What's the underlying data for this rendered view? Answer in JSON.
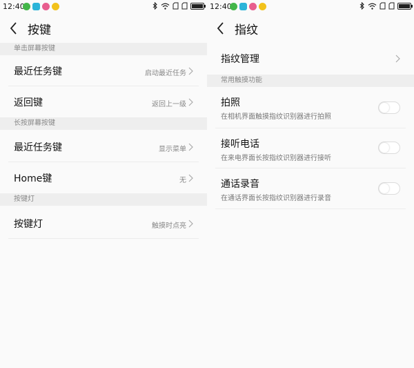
{
  "left": {
    "status": {
      "time": "12:40"
    },
    "title": "按键",
    "sections": [
      {
        "label": "单击屏幕按键"
      },
      {
        "label": "长按屏幕按键"
      },
      {
        "label": "按键灯"
      }
    ],
    "rows": [
      {
        "label": "最近任务键",
        "value": "启动最近任务"
      },
      {
        "label": "返回键",
        "value": "返回上一级"
      },
      {
        "label": "最近任务键",
        "value": "显示菜单"
      },
      {
        "label": "Home键",
        "value": "无"
      },
      {
        "label": "按键灯",
        "value": "触摸时点亮"
      }
    ]
  },
  "right": {
    "status": {
      "time": "12:40"
    },
    "title": "指纹",
    "manage": {
      "label": "指纹管理"
    },
    "section": {
      "label": "常用触摸功能"
    },
    "features": [
      {
        "label": "拍照",
        "desc": "在相机界面触摸指纹识别器进行拍照",
        "enabled": false
      },
      {
        "label": "接听电话",
        "desc": "在来电界面长按指纹识别器进行接听",
        "enabled": false
      },
      {
        "label": "通话录音",
        "desc": "在通话界面长按指纹识别器进行录音",
        "enabled": false
      }
    ]
  },
  "colors": {
    "background": "#fafafa",
    "section_bg": "#eeeeee",
    "text": "#111111",
    "secondary": "#888888"
  }
}
